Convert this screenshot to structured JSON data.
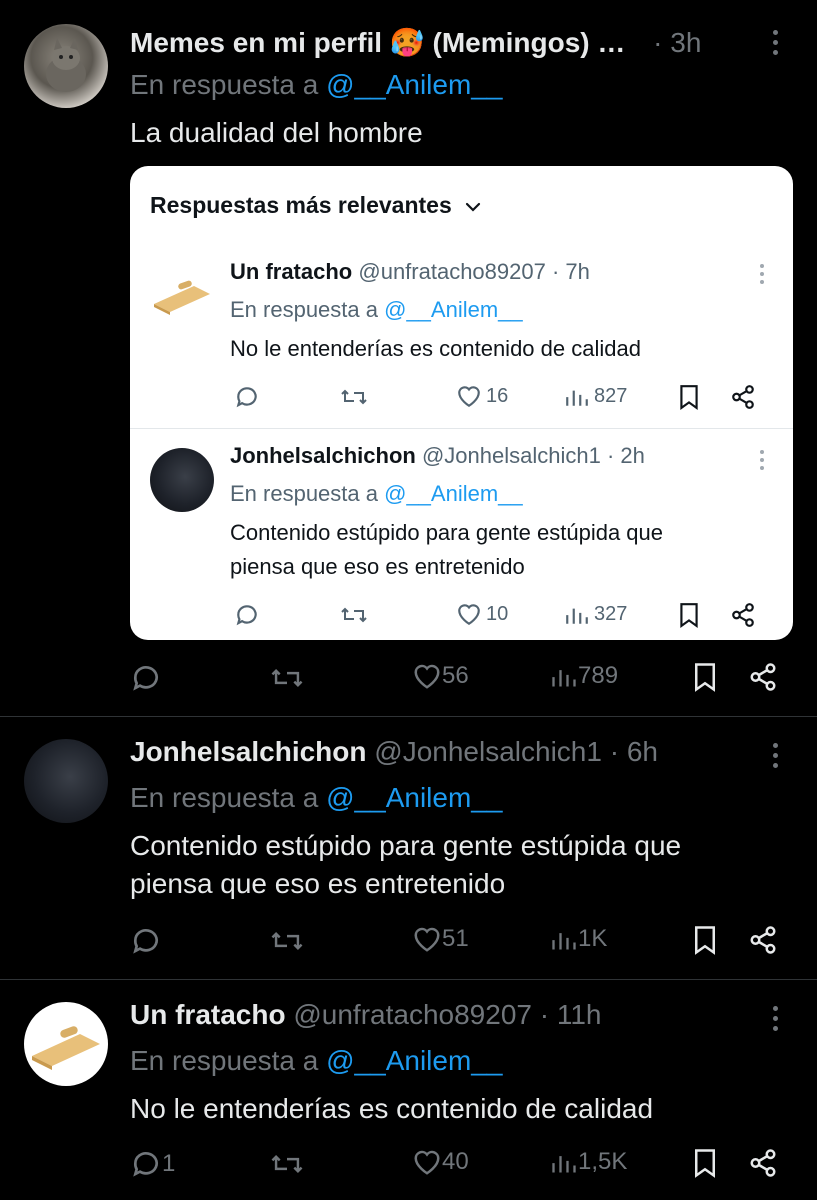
{
  "tweets": [
    {
      "display_name": "Memes en mi perfil 🥵 (Memingos) …",
      "time": "· 3h",
      "reply_prefix": "En respuesta a",
      "reply_to": "@__Anilem__",
      "text": "La dualidad del hombre",
      "embedded": {
        "title": "Respuestas más relevantes",
        "replies": [
          {
            "display_name": "Un fratacho",
            "handle_time": "@unfratacho89207 · 7h",
            "reply_prefix": "En respuesta a",
            "reply_to": "@__Anilem__",
            "text": "No le entenderías es contenido de calidad",
            "likes": "16",
            "views": "827"
          },
          {
            "display_name": "Jonhelsalchichon",
            "handle_time": "@Jonhelsalchich1 · 2h",
            "reply_prefix": "En respuesta a",
            "reply_to": "@__Anilem__",
            "text_line1": "Contenido estúpido para gente estúpida que",
            "text_line2": "piensa que eso es entretenido",
            "likes": "10",
            "views": "327"
          }
        ]
      },
      "replies": "",
      "likes": "56",
      "views": "789"
    },
    {
      "display_name": "Jonhelsalchichon",
      "handle_time": "@Jonhelsalchich1 · 6h",
      "reply_prefix": "En respuesta a",
      "reply_to": "@__Anilem__",
      "text_line1": "Contenido estúpido para gente estúpida que",
      "text_line2": "piensa que eso es entretenido",
      "replies": "",
      "likes": "51",
      "views": "1K"
    },
    {
      "display_name": "Un fratacho",
      "handle_time": "@unfratacho89207 · 11h",
      "reply_prefix": "En respuesta a",
      "reply_to": "@__Anilem__",
      "text": "No le entenderías es contenido de calidad",
      "replies": "1",
      "likes": "40",
      "views": "1,5K"
    }
  ],
  "colors": {
    "background": "#000000",
    "text": "#e7e9ea",
    "muted": "#71767b",
    "mention": "#1d9bf0",
    "card_bg": "#ffffff"
  },
  "icons": [
    "reply-icon",
    "retweet-icon",
    "like-icon",
    "views-icon",
    "bookmark-icon",
    "share-icon",
    "more-icon",
    "chevron-down-icon"
  ]
}
